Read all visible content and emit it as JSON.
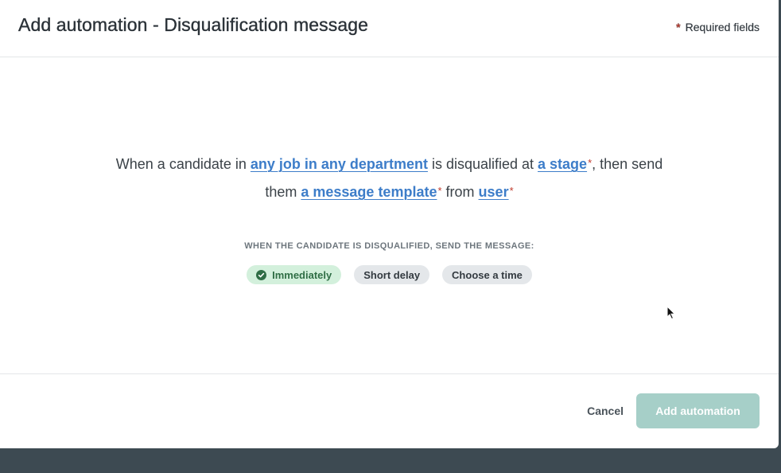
{
  "header": {
    "title": "Add automation - Disqualification message",
    "required_star": "*",
    "required_label": "Required fields"
  },
  "sentence": {
    "part1": "When a candidate in ",
    "job_link": "any job in any department",
    "part2": " is disqualified at ",
    "stage_link": "a stage",
    "part3": ", then send",
    "part4": "them ",
    "template_link": "a message template",
    "part5": " from ",
    "user_link": "user",
    "required_marker": "*"
  },
  "timing": {
    "label": "WHEN THE CANDIDATE IS DISQUALIFIED, SEND THE MESSAGE:",
    "options": [
      {
        "label": "Immediately",
        "selected": true
      },
      {
        "label": "Short delay",
        "selected": false
      },
      {
        "label": "Choose a time",
        "selected": false
      }
    ]
  },
  "footer": {
    "cancel_label": "Cancel",
    "submit_label": "Add automation"
  },
  "colors": {
    "link": "#3d7dc9",
    "required": "#c0392b",
    "selected_pill_bg": "#d3f0dc",
    "selected_pill_text": "#2f6e45",
    "submit_disabled_bg": "#a6cfc8",
    "backdrop": "#3d4a52"
  }
}
